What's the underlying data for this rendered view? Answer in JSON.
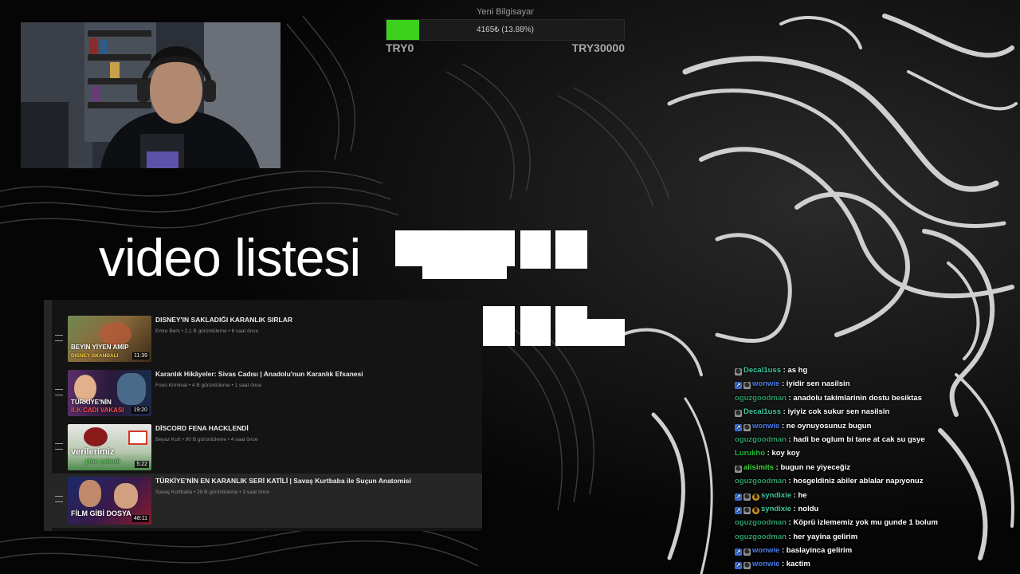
{
  "goal": {
    "title": "Yeni Bilgisayar",
    "progress_text": "4165₺ (13.88%)",
    "progress_fraction": 0.1388,
    "min_label": "TRY0",
    "max_label": "TRY30000",
    "fill_color": "#3bd11d"
  },
  "overlay_title": "video listesi",
  "videos": [
    {
      "title": "DISNEY'IN SAKLADIĞI KARANLIK SIRLAR",
      "meta": "Emre Berk • 2,1 B görüntüleme • 6 saat önce",
      "duration": "11:39",
      "thumb_line1": "BEYİN YİYEN AMİP",
      "thumb_line2": "DISNEY SKANDALI"
    },
    {
      "title": "Karanlık Hikâyeler: Sivas Cadısı | Anadolu'nun Karanlık Efsanesi",
      "meta": "Foon Kriminal • 4 B görüntüleme • 1 saat önce",
      "duration": "19:20",
      "thumb_line1": "TÜRKİYE'NİN",
      "thumb_line2": "İLK CADI VAKASI"
    },
    {
      "title": "DİSCORD FENA HACKLENDİ",
      "meta": "Beyaz Kurt • 90 B görüntüleme • 4 saat önce",
      "duration": "5:22",
      "thumb_line1": "verilerimiz",
      "thumb_line2": "yine çalındı"
    },
    {
      "title": "TÜRKİYE'NİN EN KARANLIK SERİ KATİLİ | Savaş Kurtbaba ile Suçun Anatomisi",
      "meta": "Savaş Kurtbaba • 28 B görüntüleme • 3 saat önce",
      "duration": "48:11",
      "thumb_line1": "FİLM GİBİ DOSYA",
      "thumb_line2": ""
    }
  ],
  "chat": [
    {
      "badges": [
        "g"
      ],
      "user": "Decal1uss",
      "color": "#3ec7a0",
      "text": "as hg"
    },
    {
      "badges": [
        "s",
        "g"
      ],
      "user": "wonwie",
      "color": "#4a7be8",
      "text": "iyidir sen nasilsin"
    },
    {
      "badges": [],
      "user": "oguzgoodman",
      "color": "#2f9a6a",
      "text": "anadolu takimlarinin dostu besiktas"
    },
    {
      "badges": [
        "g"
      ],
      "user": "Decal1uss",
      "color": "#3ec7a0",
      "text": "iyiyiz cok sukur sen nasilsin"
    },
    {
      "badges": [
        "s",
        "g"
      ],
      "user": "wonwie",
      "color": "#4a7be8",
      "text": "ne oynuyosunuz bugun"
    },
    {
      "badges": [],
      "user": "oguzgoodman",
      "color": "#2f9a6a",
      "text": "hadi be oglum bi tane at cak su gsye"
    },
    {
      "badges": [],
      "user": "Lurukho",
      "color": "#1fbf3a",
      "text": "koy koy"
    },
    {
      "badges": [
        "g"
      ],
      "user": "alisimits",
      "color": "#3dd63d",
      "text": "bugun ne yiyeceğiz"
    },
    {
      "badges": [],
      "user": "oguzgoodman",
      "color": "#2f9a6a",
      "text": "hosgeldiniz abiler ablalar napıyonuz"
    },
    {
      "badges": [
        "s",
        "g",
        "o"
      ],
      "user": "syndixie",
      "color": "#3ec7a0",
      "text": "he"
    },
    {
      "badges": [
        "s",
        "g",
        "o"
      ],
      "user": "syndixie",
      "color": "#3ec7a0",
      "text": "noldu"
    },
    {
      "badges": [],
      "user": "oguzgoodman",
      "color": "#2f9a6a",
      "text": "Köprü izlememiz yok mu gunde 1 bolum"
    },
    {
      "badges": [],
      "user": "oguzgoodman",
      "color": "#2f9a6a",
      "text": "her yayina gelirim"
    },
    {
      "badges": [
        "s",
        "g"
      ],
      "user": "wonwie",
      "color": "#4a7be8",
      "text": "baslayinca gelirim"
    },
    {
      "badges": [
        "s",
        "g"
      ],
      "user": "wonwie",
      "color": "#4a7be8",
      "text": "kactim"
    }
  ]
}
